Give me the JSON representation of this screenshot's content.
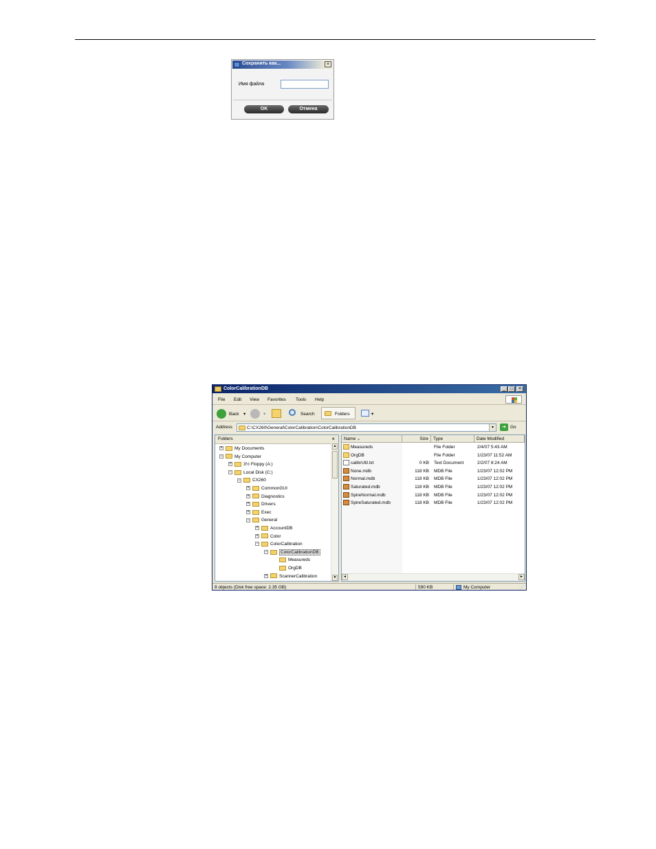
{
  "dialog": {
    "title": "Сохранить как...",
    "close": "×",
    "filename_label": "Имя файла",
    "filename_value": "",
    "ok_label": "OK",
    "cancel_label": "Отмена"
  },
  "explorer": {
    "title": "ColorCalibrationDB",
    "window_buttons": [
      "_",
      "□",
      "×"
    ],
    "menu": [
      "File",
      "Edit",
      "View",
      "Favorites",
      "Tools",
      "Help"
    ],
    "toolbar": {
      "back": "Back",
      "search": "Search",
      "folders": "Folders",
      "back_icon": "back-arrow-icon",
      "forward_icon": "forward-arrow-icon",
      "up_icon": "up-folder-icon",
      "search_icon": "magnifier-icon",
      "folders_icon": "folders-icon",
      "views_icon": "views-icon"
    },
    "address": {
      "label": "Address",
      "path": "C:\\CX260\\General\\ColorCalibration\\ColorCalibrationDB",
      "go": "Go"
    },
    "folders_pane": {
      "title": "Folders",
      "close": "×",
      "tree": [
        {
          "label": "My Documents",
          "expander": "+"
        },
        {
          "label": "My Computer",
          "expander": "−"
        },
        {
          "label": "3½ Floppy (A:)",
          "expander": "+"
        },
        {
          "label": "Local Disk (C:)",
          "expander": "−"
        },
        {
          "label": "CX260",
          "expander": "−"
        },
        {
          "label": "CommonGUI",
          "expander": "+"
        },
        {
          "label": "Diagnostics",
          "expander": "+"
        },
        {
          "label": "Drivers",
          "expander": "+"
        },
        {
          "label": "Exec",
          "expander": "+"
        },
        {
          "label": "General",
          "expander": "−"
        },
        {
          "label": "AccountDB",
          "expander": "+"
        },
        {
          "label": "Color",
          "expander": "+"
        },
        {
          "label": "ColorCalibration",
          "expander": "−"
        },
        {
          "label": "ColorCalibrationDB",
          "expander": "−"
        },
        {
          "label": "Measureds",
          "expander": ""
        },
        {
          "label": "OrgDB",
          "expander": ""
        },
        {
          "label": "ScannerCalibration",
          "expander": "+"
        }
      ]
    },
    "list": {
      "columns": [
        "Name",
        "Size",
        "Type",
        "Date Modified"
      ],
      "rows": [
        {
          "name": "Measureds",
          "size": "",
          "type": "File Folder",
          "date": "2/4/07 5:43 AM",
          "icon": "folder-icon"
        },
        {
          "name": "OrgDB",
          "size": "",
          "type": "File Folder",
          "date": "1/23/07 11:52 AM",
          "icon": "folder-icon"
        },
        {
          "name": "calibrUtil.txt",
          "size": "0 KB",
          "type": "Text Document",
          "date": "2/2/07 8:24 AM",
          "icon": "text-file-icon"
        },
        {
          "name": "None.mdb",
          "size": "118 KB",
          "type": "MDB File",
          "date": "1/23/07 12:02 PM",
          "icon": "mdb-file-icon"
        },
        {
          "name": "Normal.mdb",
          "size": "118 KB",
          "type": "MDB File",
          "date": "1/23/07 12:02 PM",
          "icon": "mdb-file-icon"
        },
        {
          "name": "Saturated.mdb",
          "size": "118 KB",
          "type": "MDB File",
          "date": "1/23/07 12:02 PM",
          "icon": "mdb-file-icon"
        },
        {
          "name": "SpireNormal.mdb",
          "size": "118 KB",
          "type": "MDB File",
          "date": "1/23/07 12:02 PM",
          "icon": "mdb-file-icon"
        },
        {
          "name": "SpireSaturated.mdb",
          "size": "118 KB",
          "type": "MDB File",
          "date": "1/23/07 12:02 PM",
          "icon": "mdb-file-icon"
        }
      ]
    },
    "status": {
      "objects": "8 objects (Disk free space: 2.35 GB)",
      "size": "590 KB",
      "location": "My Computer"
    }
  }
}
